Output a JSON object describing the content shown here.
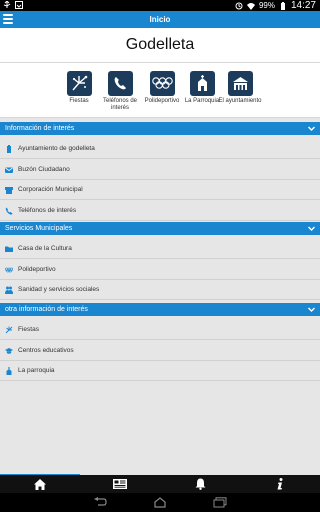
{
  "status_bar": {
    "battery": "99%",
    "time": "14:27"
  },
  "topbar": {
    "title": "Inicio"
  },
  "header": {
    "title": "Godelleta"
  },
  "quick_links": [
    {
      "label": "Fiestas",
      "icon": "fireworks-icon"
    },
    {
      "label": "Teléfonos de interés",
      "icon": "phone-icon"
    },
    {
      "label": "Polideportivo",
      "icon": "olympic-rings-icon"
    },
    {
      "label": "La Parroquia",
      "icon": "church-icon"
    },
    {
      "label": "El ayuntamiento",
      "icon": "town-hall-icon"
    }
  ],
  "sections": [
    {
      "title": "Información de interés",
      "items": [
        {
          "label": "Ayuntamiento de godelleta",
          "icon": "building-icon"
        },
        {
          "label": "Buzón Ciudadano",
          "icon": "mailbox-icon"
        },
        {
          "label": "Corporación Municipal",
          "icon": "group-icon"
        },
        {
          "label": "Teléfonos de interés",
          "icon": "phone-icon"
        }
      ]
    },
    {
      "title": "Servicios Municipales",
      "items": [
        {
          "label": "Casa de la Cultura",
          "icon": "folder-icon"
        },
        {
          "label": "Polideportivo",
          "icon": "olympic-rings-icon"
        },
        {
          "label": "Sanidad y servicios sociales",
          "icon": "people-icon"
        }
      ]
    },
    {
      "title": "otra información de interés",
      "items": [
        {
          "label": "Fiestas",
          "icon": "fireworks-icon"
        },
        {
          "label": "Centros educativos",
          "icon": "graduation-cap-icon"
        },
        {
          "label": "La parroquia",
          "icon": "church-icon"
        }
      ]
    }
  ],
  "bottom_nav": [
    {
      "icon": "home-icon"
    },
    {
      "icon": "news-icon"
    },
    {
      "icon": "bell-icon"
    },
    {
      "icon": "info-icon"
    }
  ],
  "colors": {
    "accent": "#1a86d0",
    "icon_tile": "#1d3c5c",
    "background": "#e6e6e6"
  }
}
